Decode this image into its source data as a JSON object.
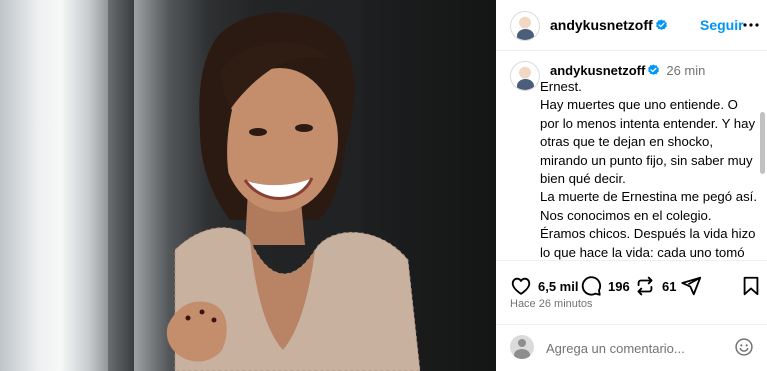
{
  "post": {
    "username": "andykusnetzoff",
    "follow_label": "Seguir",
    "verified": true,
    "accent_color": "#0095f6"
  },
  "caption": {
    "username": "andykusnetzoff",
    "time": "26 min",
    "paragraphs": [
      "Ernest.",
      "Hay muertes que uno entiende. O por lo menos intenta entender. Y hay otras que te dejan en shocko, mirando un punto fijo, sin saber muy bien qué decir.",
      "La muerte de Ernestina me pegó así. Nos conocimos en el colegio. Éramos chicos. Después la vida hizo lo que hace la vida: cada uno tomó su camino, armó su carrera, sus historias, sus amores, sus líos, sus éxitos y sus"
    ]
  },
  "actions": {
    "likes_count": "6,5 mil",
    "comments_count": "196",
    "reposts_count": "61",
    "timestamp": "Hace 26 minutos"
  },
  "comment_box": {
    "placeholder": "Agrega un comentario..."
  },
  "icons": [
    "verified-badge-icon",
    "more-icon",
    "heart-icon",
    "comment-icon",
    "repost-icon",
    "share-icon",
    "bookmark-icon",
    "emoji-icon"
  ]
}
